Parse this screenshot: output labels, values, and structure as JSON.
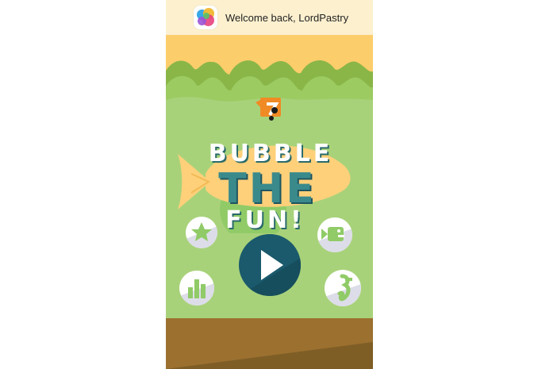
{
  "banner": {
    "welcome_text": "Welcome back, LordPastry",
    "icon": "game-center-icon"
  },
  "title": {
    "line1": "BUBBLE",
    "line2": "THE",
    "line3": "FUN!"
  },
  "buttons": {
    "play": "play-icon",
    "favorite": "star-icon",
    "fish": "fish-icon",
    "leaderboard": "bar-chart-icon",
    "seahorse": "seahorse-icon"
  },
  "colors": {
    "grass": "#a8d27a",
    "sky": "#fccd6b",
    "banner": "#fdf0cf",
    "fish": "#fed07a",
    "title_text": "#ffffff",
    "title_the": "#3a8a8c",
    "play_button": "#1a5a6c",
    "button_accent": "#90cb67",
    "ground": "#9c7130"
  }
}
